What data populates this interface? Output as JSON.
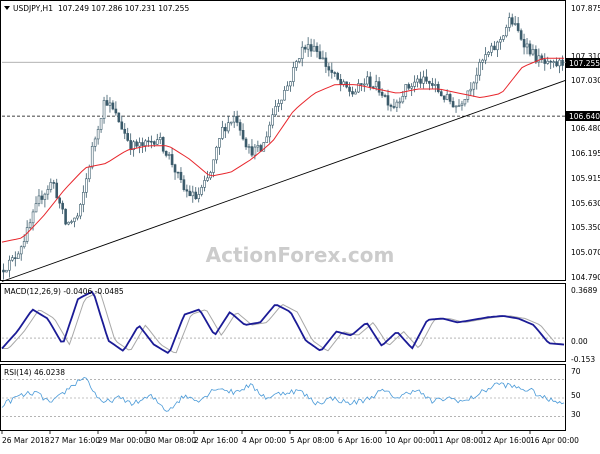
{
  "colors": {
    "background": "#ffffff",
    "border": "#000000",
    "candle": "#3a5a6a",
    "ma": "#e8262c",
    "macd_main": "#1b1b96",
    "macd_signal": "#a8a8a8",
    "rsi": "#4a9ad8",
    "trendline": "#000000",
    "levels": "#000000",
    "watermark": "#cccccc"
  },
  "header": {
    "symbol_timeframe": "USDJPY,H1",
    "ohlc": "107.249 107.286 107.231 107.255",
    "dropdown_icon": "triangle-down-icon"
  },
  "watermark": "ActionForex.com",
  "price_axis": {
    "labels": [
      "107.875",
      "107.310",
      "107.030",
      "106.480",
      "106.195",
      "105.915",
      "105.630",
      "105.350",
      "105.070",
      "104.790"
    ],
    "current_price": "107.255",
    "level_price": "106.640"
  },
  "macd": {
    "label": "MACD(12,26,9) -0.0406 -0.0485",
    "axis": [
      "0.3689",
      "0.00",
      "-0.153"
    ]
  },
  "rsi": {
    "label": "RSI(14) 46.0238",
    "axis": [
      "70",
      "50",
      "30"
    ]
  },
  "time_axis": [
    "26 Mar 2018",
    "27 Mar 16:00",
    "29 Mar 00:00",
    "30 Mar 08:00",
    "2 Apr 16:00",
    "4 Apr 00:00",
    "5 Apr 08:00",
    "6 Apr 16:00",
    "10 Apr 00:00",
    "11 Apr 08:00",
    "12 Apr 16:00",
    "16 Apr 00:00"
  ],
  "chart_data": {
    "type": "candlestick",
    "symbol": "USDJPY",
    "timeframe": "H1",
    "price_anchors": [
      104.88,
      105.0,
      105.3,
      105.7,
      105.9,
      105.4,
      105.5,
      106.25,
      106.85,
      106.6,
      106.3,
      106.3,
      106.4,
      106.15,
      105.8,
      105.7,
      105.95,
      106.5,
      106.65,
      106.25,
      106.25,
      106.75,
      107.0,
      107.4,
      107.45,
      107.2,
      107.0,
      106.9,
      107.05,
      106.95,
      106.75,
      106.95,
      107.05,
      107.0,
      106.85,
      106.75,
      107.0,
      107.3,
      107.45,
      107.75,
      107.5,
      107.3,
      107.2,
      107.25
    ],
    "ma_anchors": [
      105.2,
      105.25,
      105.5,
      105.8,
      106.05,
      106.1,
      106.25,
      106.3,
      106.3,
      106.15,
      105.95,
      106.0,
      106.15,
      106.35,
      106.7,
      106.9,
      107.0,
      107.0,
      106.95,
      106.9,
      106.95,
      106.95,
      106.9,
      106.85,
      106.9,
      107.2,
      107.3,
      107.3
    ],
    "levels": [
      107.255,
      106.64
    ],
    "trendline": {
      "from": 104.75,
      "to": 107.05
    },
    "macd_anchors": [
      -0.08,
      0.05,
      0.22,
      0.15,
      -0.05,
      0.3,
      0.36,
      -0.02,
      -0.1,
      0.1,
      -0.05,
      -0.12,
      0.18,
      0.22,
      0.02,
      0.2,
      0.1,
      0.12,
      0.26,
      0.2,
      -0.02,
      -0.1,
      0.05,
      0.02,
      0.12,
      -0.06,
      0.05,
      -0.08,
      0.14,
      0.15,
      0.12,
      0.14,
      0.16,
      0.17,
      0.15,
      0.1,
      -0.04,
      -0.05
    ],
    "macd_range": [
      -0.153,
      0.3689
    ],
    "rsi_anchors": [
      42,
      52,
      56,
      44,
      60,
      74,
      44,
      50,
      44,
      52,
      36,
      52,
      48,
      62,
      56,
      64,
      50,
      56,
      58,
      44,
      50,
      44,
      48,
      58,
      50,
      60,
      46,
      50,
      46,
      56,
      66,
      62,
      58,
      48,
      46
    ],
    "rsi_range": [
      15,
      85
    ],
    "rsi_levels": [
      70,
      50,
      30
    ]
  }
}
